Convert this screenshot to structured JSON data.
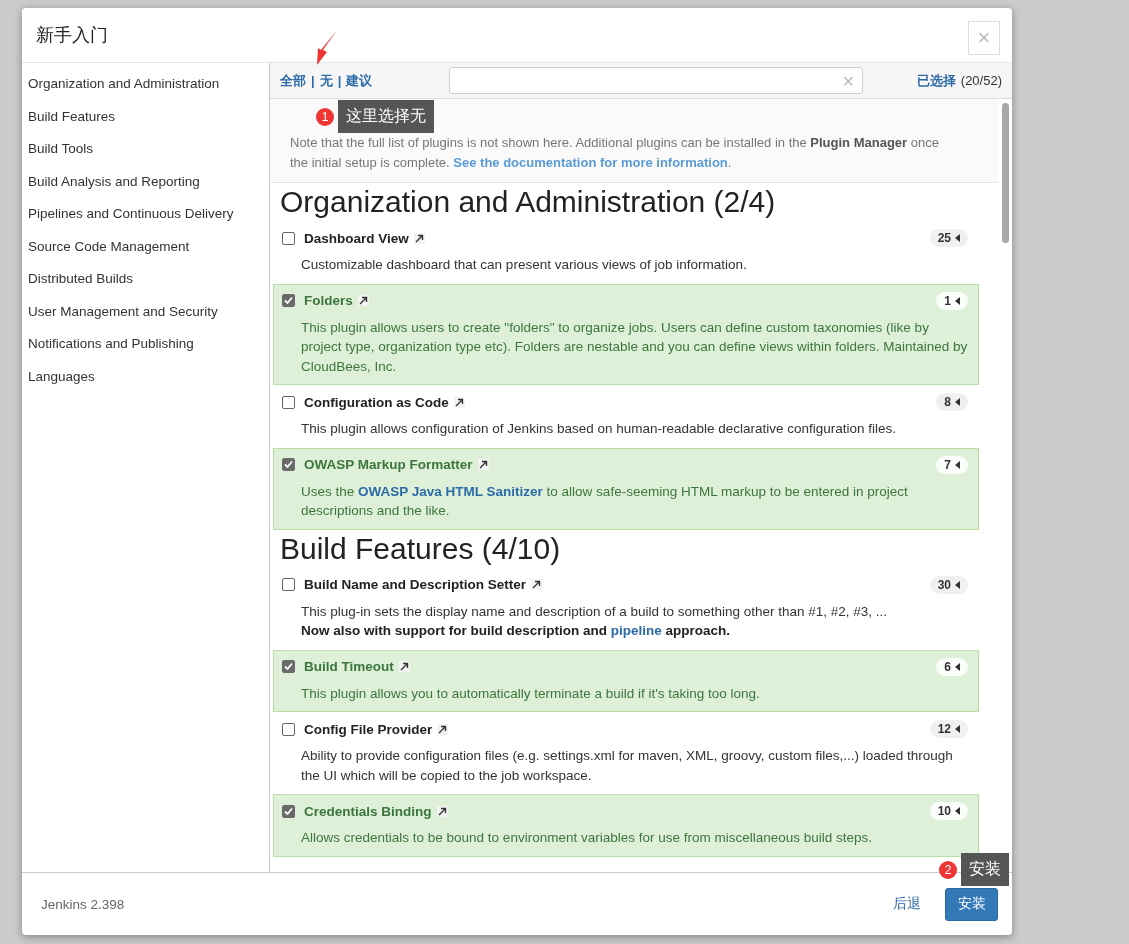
{
  "dialog": {
    "title": "新手入门",
    "close": "×"
  },
  "sidebar": {
    "items": [
      {
        "label": "Organization and Administration",
        "selected": false
      },
      {
        "label": "Build Features",
        "selected": false
      },
      {
        "label": "Build Tools",
        "selected": false
      },
      {
        "label": "Build Analysis and Reporting",
        "selected": false
      },
      {
        "label": "Pipelines and Continuous Delivery",
        "selected": false
      },
      {
        "label": "Source Code Management",
        "selected": false
      },
      {
        "label": "Distributed Builds",
        "selected": false
      },
      {
        "label": "User Management and Security",
        "selected": false
      },
      {
        "label": "Notifications and Publishing",
        "selected": false
      },
      {
        "label": "Languages",
        "selected": false
      }
    ]
  },
  "toolbar": {
    "filters": [
      "全部",
      "无",
      "建议"
    ],
    "separator": "|",
    "search": {
      "clear": "×"
    },
    "selected_link": "已选择",
    "selected_count": "(20/52)"
  },
  "note": [
    {
      "kind": "plain",
      "text": "Note that the full list of plugins is not shown here. Additional plugins can be installed in the "
    },
    {
      "kind": "bold",
      "text": "Plugin Manager"
    },
    {
      "kind": "plain",
      "text": " once the initial setup is complete. "
    },
    {
      "kind": "link",
      "text": "See the documentation for more information"
    },
    {
      "kind": "plain",
      "text": "."
    }
  ],
  "sections": [
    {
      "title": "Organization and Administration (2/4)",
      "plugins": [
        {
          "name": "Dashboard View",
          "checked": false,
          "count": "25",
          "lines": [
            [
              {
                "kind": "plain",
                "text": "Customizable dashboard that can present various views of job information."
              }
            ]
          ]
        },
        {
          "name": "Folders",
          "checked": true,
          "count": "1",
          "lines": [
            [
              {
                "kind": "plain",
                "text": "This plugin allows users to create \"folders\" to organize jobs. Users can define custom taxonomies (like by project type, organization type etc). Folders are nestable and you can define views within folders. Maintained by CloudBees, Inc."
              }
            ]
          ]
        },
        {
          "name": "Configuration as Code",
          "checked": false,
          "count": "8",
          "lines": [
            [
              {
                "kind": "plain",
                "text": "This plugin allows configuration of Jenkins based on human-readable declarative configuration files."
              }
            ]
          ]
        },
        {
          "name": "OWASP Markup Formatter",
          "checked": true,
          "count": "7",
          "lines": [
            [
              {
                "kind": "plain",
                "text": "Uses the "
              },
              {
                "kind": "link",
                "text": "OWASP Java HTML Sanitizer"
              },
              {
                "kind": "plain",
                "text": " to allow safe-seeming HTML markup to be entered in project descriptions and the like."
              }
            ]
          ]
        }
      ]
    },
    {
      "title": "Build Features (4/10)",
      "plugins": [
        {
          "name": "Build Name and Description Setter",
          "checked": false,
          "count": "30",
          "lines": [
            [
              {
                "kind": "plain",
                "text": "This plug-in sets the display name and description of a build to something other than #1, #2, #3, ..."
              }
            ],
            [
              {
                "kind": "bold",
                "text": "Now also with support for build description and "
              },
              {
                "kind": "link",
                "text": "pipeline"
              },
              {
                "kind": "bold",
                "text": " approach."
              }
            ]
          ]
        },
        {
          "name": "Build Timeout",
          "checked": true,
          "count": "6",
          "lines": [
            [
              {
                "kind": "plain",
                "text": "This plugin allows you to automatically terminate a build if it's taking too long."
              }
            ]
          ]
        },
        {
          "name": "Config File Provider",
          "checked": false,
          "count": "12",
          "lines": [
            [
              {
                "kind": "plain",
                "text": "Ability to provide configuration files (e.g. settings.xml for maven, XML, groovy, custom files,...) loaded through the UI which will be copied to the job workspace."
              }
            ]
          ]
        },
        {
          "name": "Credentials Binding",
          "checked": true,
          "count": "10",
          "lines": [
            [
              {
                "kind": "plain",
                "text": "Allows credentials to be bound to environment variables for use from miscellaneous build steps."
              }
            ]
          ]
        }
      ]
    }
  ],
  "footer": {
    "version": "Jenkins 2.398",
    "back": "后退",
    "install": "安装"
  },
  "annotations": [
    {
      "number": "1",
      "text": "这里选择无"
    },
    {
      "number": "2",
      "text": "安装"
    }
  ]
}
